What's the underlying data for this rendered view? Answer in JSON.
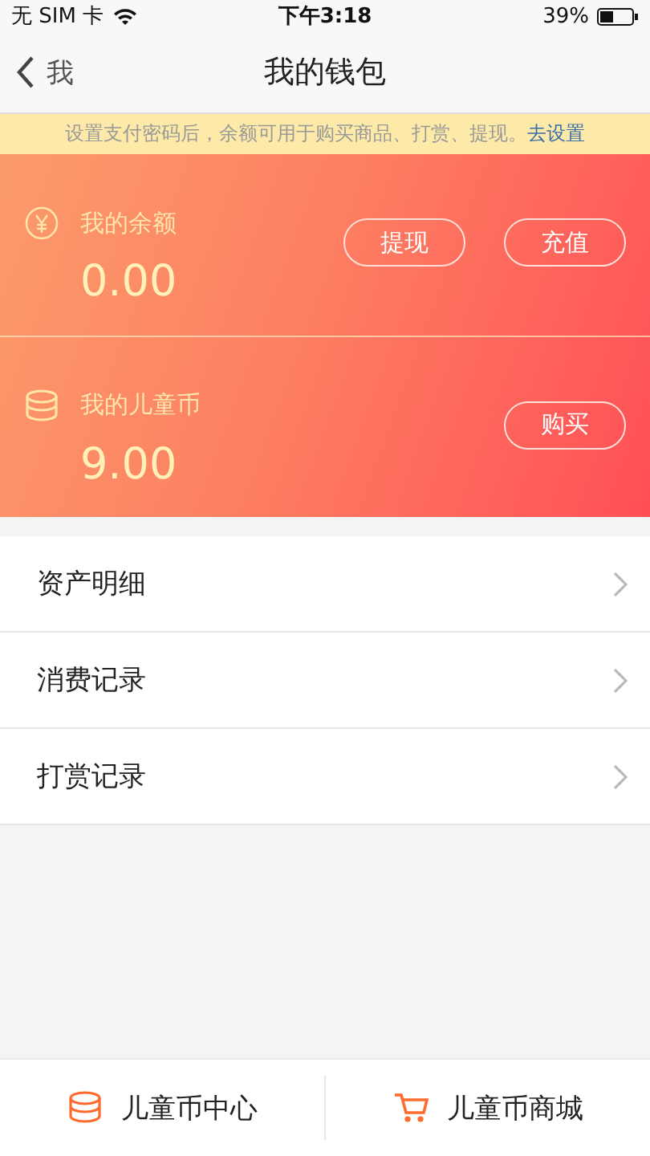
{
  "status_bar": {
    "carrier": "无 SIM 卡",
    "time": "下午3:18",
    "battery": "39%"
  },
  "nav": {
    "back_label": "我",
    "title": "我的钱包"
  },
  "notice": {
    "text": "设置支付密码后，余额可用于购买商品、打赏、提现。",
    "link": "去设置"
  },
  "accounts": [
    {
      "kind": "yuan",
      "label": "我的余额",
      "amount": "0.00",
      "actions": [
        "提现",
        "充值"
      ]
    },
    {
      "kind": "coins",
      "label": "我的儿童币",
      "amount": "9.00",
      "actions": [
        "购买"
      ]
    }
  ],
  "menu": [
    "资产明细",
    "消费记录",
    "打赏记录"
  ],
  "bottom_tabs": [
    {
      "kind": "coins",
      "label": "儿童币中心"
    },
    {
      "kind": "cart",
      "label": "儿童币商城"
    }
  ]
}
